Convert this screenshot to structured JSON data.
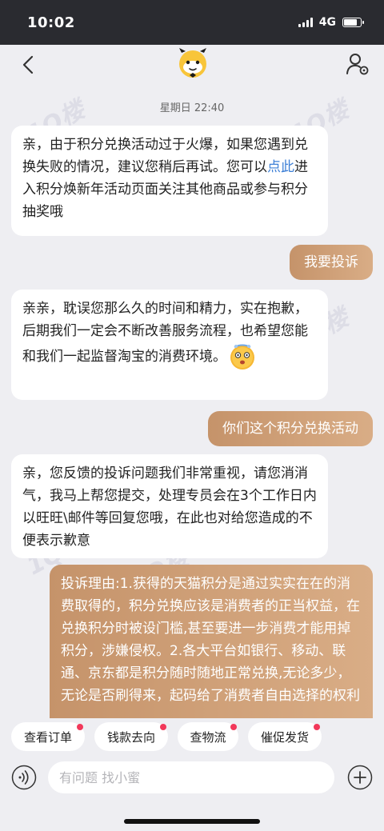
{
  "status": {
    "time": "10:02",
    "network": "4G"
  },
  "nav": {
    "avatar_icon": "bot-avatar-icon"
  },
  "chat": {
    "timestamp": "星期日 22:40",
    "m1": {
      "pre": "亲，由于积分兑换活动过于火爆，如果您遇到兑换失败的情况，建议您稍后再试。您可以",
      "link": "点此",
      "post": "进入积分焕新年活动页面关注其他商品或参与积分抽奖哦"
    },
    "m2": "我要投诉",
    "m3": "亲亲，耽误您那么久的时间和精力，实在抱歉，后期我们一定会不断改善服务流程，也希望您能和我们一起监督淘宝的消费环境。",
    "m4": "你们这个积分兑换活动",
    "m5": "亲，您反馈的投诉问题我们非常重视，请您消消气，我马上帮您提交，处理专员会在3个工作日内以旺旺\\邮件等回复您哦，在此也对给您造成的不便表示歉意",
    "m6": "投诉理由:1.获得的天猫积分是通过实实在在的消费取得的，积分兑换应该是消费者的正当权益，在兑换积分时被设门槛,甚至要进一步消费才能用掉积分，涉嫌侵权。2.各大平台如银行、移动、联通、京东都是积分随时随地正常兑换,无论多少，无论是否刷得来，起码给了消费者自由选择的权利"
  },
  "quick_actions": [
    "查看订单",
    "钱款去向",
    "查物流",
    "催促发货"
  ],
  "input": {
    "placeholder": "有问题 找小蜜"
  },
  "watermark": "1Q楼",
  "colors": {
    "accent": "#c5936a",
    "link": "#3d7fd6",
    "badge": "#f2385a"
  }
}
